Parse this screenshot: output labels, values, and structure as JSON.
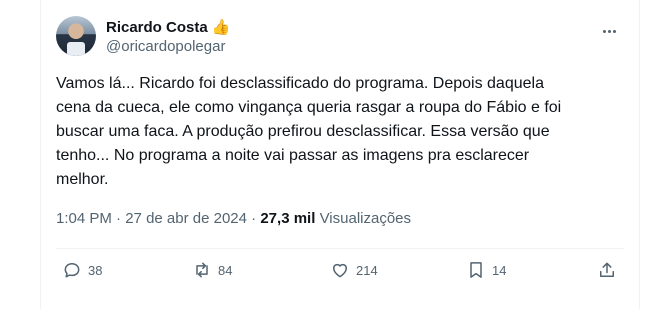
{
  "author": {
    "display_name": "Ricardo Costa",
    "badge_icon": "thumbs-up-emoji-icon",
    "handle": "@oricardopolegar"
  },
  "tweet": {
    "text": "Vamos lá... Ricardo foi desclassificado do programa. Depois daquela\ncena da cueca, ele como vingança queria rasgar a roupa do Fábio e foi\nbuscar uma faca. A produção prefirou desclassificar. Essa versão que\ntenho... No programa a noite vai passar as imagens pra esclarecer\nmelhor.",
    "time": "1:04 PM",
    "date": "27 de abr de 2024",
    "separator": "·",
    "views_count": "27,3 mil",
    "views_label": "Visualizações"
  },
  "actions": {
    "replies": "38",
    "retweets": "84",
    "likes": "214",
    "bookmarks": "14"
  },
  "colors": {
    "text_primary": "#0f1419",
    "text_secondary": "#536471",
    "divider": "#eff3f4"
  }
}
